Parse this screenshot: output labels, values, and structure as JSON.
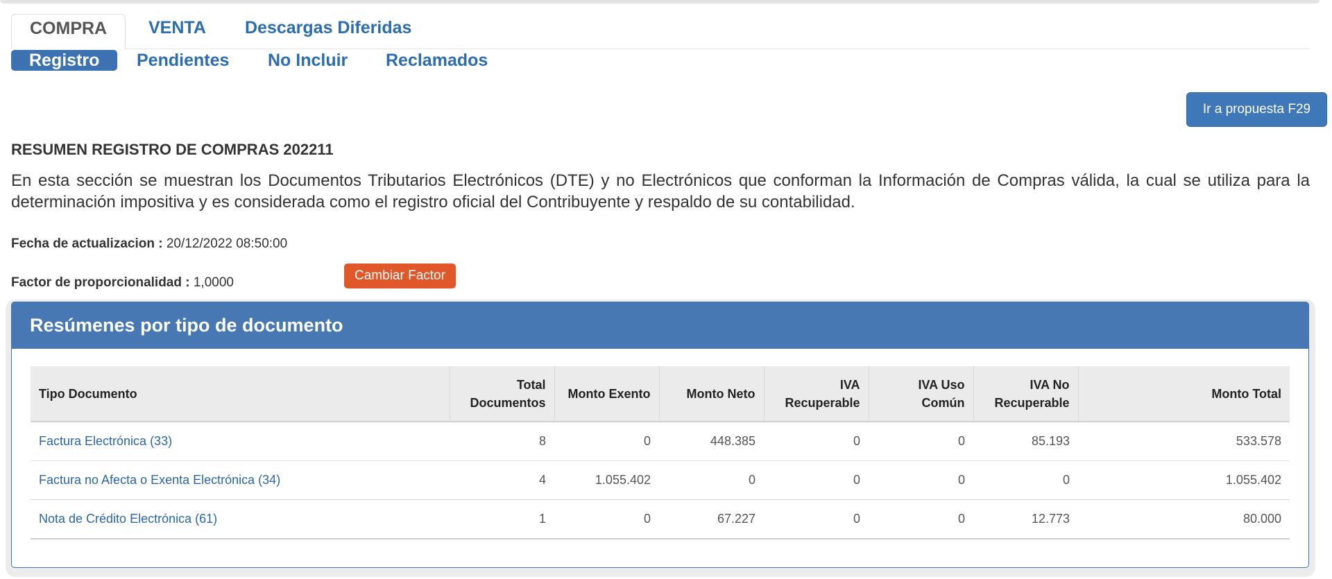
{
  "main_tabs": [
    {
      "label": "COMPRA",
      "active": true
    },
    {
      "label": "VENTA",
      "active": false
    },
    {
      "label": "Descargas Diferidas",
      "active": false
    }
  ],
  "sub_tabs": [
    {
      "label": "Registro",
      "active": true
    },
    {
      "label": "Pendientes",
      "active": false
    },
    {
      "label": "No Incluir",
      "active": false
    },
    {
      "label": "Reclamados",
      "active": false
    }
  ],
  "actions": {
    "f29_label": "Ir a propuesta F29",
    "cambiar_factor_label": "Cambiar Factor"
  },
  "resumen": {
    "title": "RESUMEN REGISTRO DE COMPRAS 202211",
    "intro": "En esta sección se muestran los Documentos Tributarios Electrónicos (DTE) y no Electrónicos que conforman la Información de Compras válida, la cual se utiliza para la determinación impositiva y es considerada como el registro oficial del Contribuyente y respaldo de su contabilidad.",
    "fecha_label": "Fecha de actualizacion :",
    "fecha_value": "20/12/2022 08:50:00",
    "factor_label": "Factor de proporcionalidad :",
    "factor_value": "1,0000"
  },
  "panel": {
    "title": "Resúmenes por tipo de documento",
    "columns": [
      "Tipo Documento",
      "Total Documentos",
      "Monto Exento",
      "Monto Neto",
      "IVA Recuperable",
      "IVA Uso Común",
      "IVA No Recuperable",
      "Monto Total"
    ],
    "rows": [
      {
        "cells": [
          "Factura Electrónica (33)",
          "8",
          "0",
          "448.385",
          "0",
          "0",
          "85.193",
          "533.578"
        ]
      },
      {
        "cells": [
          "Factura no Afecta o Exenta Electrónica (34)",
          "4",
          "1.055.402",
          "0",
          "0",
          "0",
          "0",
          "1.055.402"
        ]
      },
      {
        "cells": [
          "Nota de Crédito Electrónica (61)",
          "1",
          "0",
          "67.227",
          "0",
          "0",
          "12.773",
          "80.000"
        ]
      }
    ]
  },
  "colors": {
    "accent_blue": "#3c72b2",
    "panel_header": "#4778b4",
    "link_blue": "#2b6db0",
    "orange_button": "#e0582a"
  }
}
